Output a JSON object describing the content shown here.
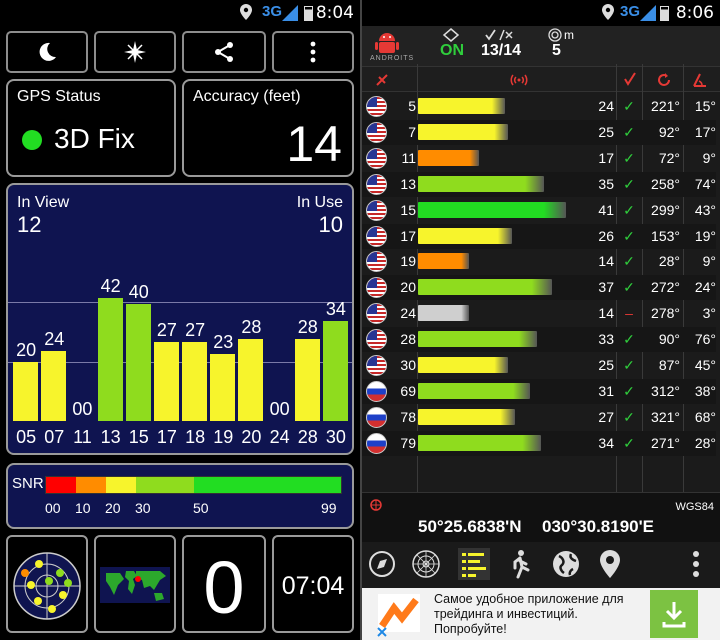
{
  "left": {
    "status_bar": {
      "network": "3G",
      "time": "8:04"
    },
    "toolbar": {
      "night_icon": "moon-icon",
      "compass_icon": "star-icon",
      "share_icon": "share-icon",
      "menu_icon": "more-vert-icon"
    },
    "gps_status": {
      "title": "GPS Status",
      "value": "3D Fix",
      "indicator_color": "#22dd22"
    },
    "accuracy": {
      "title": "Accuracy (feet)",
      "value": "14"
    },
    "satellites": {
      "in_view_label": "In View",
      "in_view": "12",
      "in_use_label": "In Use",
      "in_use": "10"
    },
    "chart_data": {
      "type": "bar",
      "categories": [
        "05",
        "07",
        "11",
        "13",
        "15",
        "17",
        "18",
        "19",
        "20",
        "24",
        "28",
        "30"
      ],
      "values": [
        20,
        24,
        0,
        42,
        40,
        27,
        27,
        23,
        28,
        0,
        28,
        34
      ],
      "value_labels": [
        "20",
        "24",
        "00",
        "42",
        "40",
        "27",
        "27",
        "23",
        "28",
        "00",
        "28",
        "34"
      ],
      "colors": [
        "#f7f42c",
        "#f7f42c",
        "#f7f42c",
        "#8fdc1e",
        "#8fdc1e",
        "#f7f42c",
        "#f7f42c",
        "#f7f42c",
        "#f7f42c",
        "#f7f42c",
        "#f7f42c",
        "#8fdc1e"
      ],
      "ylim": [
        0,
        60
      ]
    },
    "snr_legend": {
      "label": "SNR",
      "ticks": [
        "00",
        "10",
        "20",
        "30",
        "50",
        "99"
      ],
      "colors": [
        "#ff0000",
        "#ff8c00",
        "#f7f42c",
        "#8fdc1e",
        "#22dd22"
      ]
    },
    "bottom": {
      "radar_icon": "satellite-radar-icon",
      "map_icon": "world-map-icon",
      "speed": "0",
      "clock": "07:04"
    }
  },
  "right": {
    "status_bar": {
      "network": "3G",
      "time": "8:06"
    },
    "header": {
      "app_icon": "android-robot-icon",
      "app_name": "ANDROITS",
      "gps_state": "ON",
      "sats_used": "13/14",
      "accuracy": "5",
      "accuracy_unit": "m"
    },
    "columns": {
      "flag_icon": "satellite-icon",
      "signal_icon": "signal-icon",
      "used_icon": "check-icon",
      "azimuth_icon": "azimuth-icon",
      "elevation_icon": "elevation-icon"
    },
    "satellites": [
      {
        "prn": "5",
        "snr": "24",
        "used": "✓",
        "azimuth": "221°",
        "elevation": "15°",
        "color": "#f7f42c",
        "country": "us",
        "snr_value": 24
      },
      {
        "prn": "7",
        "snr": "25",
        "used": "✓",
        "azimuth": "92°",
        "elevation": "17°",
        "color": "#f7f42c",
        "country": "us",
        "snr_value": 25
      },
      {
        "prn": "11",
        "snr": "17",
        "used": "✓",
        "azimuth": "72°",
        "elevation": "9°",
        "color": "#ff8c00",
        "country": "us",
        "snr_value": 17
      },
      {
        "prn": "13",
        "snr": "35",
        "used": "✓",
        "azimuth": "258°",
        "elevation": "74°",
        "color": "#8fdc1e",
        "country": "us",
        "snr_value": 35
      },
      {
        "prn": "15",
        "snr": "41",
        "used": "✓",
        "azimuth": "299°",
        "elevation": "43°",
        "color": "#22dd22",
        "country": "us",
        "snr_value": 41
      },
      {
        "prn": "17",
        "snr": "26",
        "used": "✓",
        "azimuth": "153°",
        "elevation": "19°",
        "color": "#f7f42c",
        "country": "us",
        "snr_value": 26
      },
      {
        "prn": "19",
        "snr": "14",
        "used": "✓",
        "azimuth": "28°",
        "elevation": "9°",
        "color": "#ff8c00",
        "country": "us",
        "snr_value": 14
      },
      {
        "prn": "20",
        "snr": "37",
        "used": "✓",
        "azimuth": "272°",
        "elevation": "24°",
        "color": "#8fdc1e",
        "country": "us",
        "snr_value": 37
      },
      {
        "prn": "24",
        "snr": "14",
        "used": "–",
        "azimuth": "278°",
        "elevation": "3°",
        "color": "#cfcfcf",
        "country": "us",
        "snr_value": 14
      },
      {
        "prn": "28",
        "snr": "33",
        "used": "✓",
        "azimuth": "90°",
        "elevation": "76°",
        "color": "#8fdc1e",
        "country": "us",
        "snr_value": 33
      },
      {
        "prn": "30",
        "snr": "25",
        "used": "✓",
        "azimuth": "87°",
        "elevation": "45°",
        "color": "#f7f42c",
        "country": "us",
        "snr_value": 25
      },
      {
        "prn": "69",
        "snr": "31",
        "used": "✓",
        "azimuth": "312°",
        "elevation": "38°",
        "color": "#8fdc1e",
        "country": "ru",
        "snr_value": 31
      },
      {
        "prn": "78",
        "snr": "27",
        "used": "✓",
        "azimuth": "321°",
        "elevation": "68°",
        "color": "#f7f42c",
        "country": "ru",
        "snr_value": 27
      },
      {
        "prn": "79",
        "snr": "34",
        "used": "✓",
        "azimuth": "271°",
        "elevation": "28°",
        "color": "#8fdc1e",
        "country": "ru",
        "snr_value": 34
      }
    ],
    "position": {
      "datum": "WGS84",
      "latitude": "50°25.6838'N",
      "longitude": "030°30.8190'E"
    },
    "nav": [
      "compass-icon",
      "radar-icon",
      "signal-bars-icon",
      "walker-icon",
      "globe-icon",
      "location-pin-icon",
      "more-vert-icon"
    ],
    "ad": {
      "line1": "Самое удобное приложение для",
      "line2": "трейдинга и инвестиций.",
      "line3": "Попробуйте!",
      "download_icon": "download-icon",
      "close_icon": "close-icon"
    }
  }
}
